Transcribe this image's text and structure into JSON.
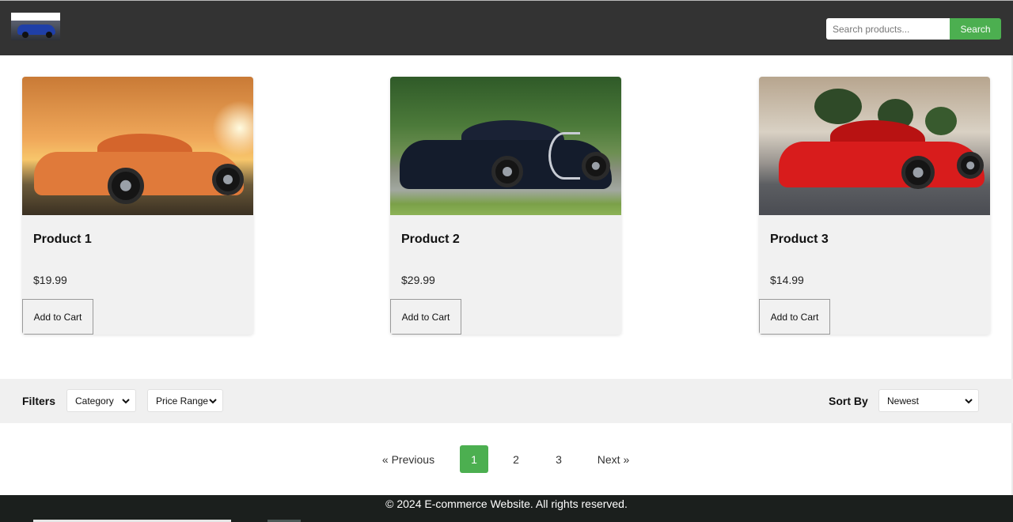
{
  "header": {
    "logo_alt": "car logo",
    "search_placeholder": "Search products...",
    "search_button": "Search"
  },
  "products": [
    {
      "name": "Product 1",
      "price": "$19.99",
      "button": "Add to Cart",
      "image": "orange sports car at sunset",
      "color": "#e07a3a"
    },
    {
      "name": "Product 2",
      "price": "$29.99",
      "button": "Add to Cart",
      "image": "black hypercar on track",
      "color": "#141c2c"
    },
    {
      "name": "Product 3",
      "price": "$14.99",
      "button": "Add to Cart",
      "image": "red supercar on street",
      "color": "#d81c1c"
    }
  ],
  "filters": {
    "label": "Filters",
    "category": "Category",
    "price_range": "Price Range",
    "sort_label": "Sort By",
    "sort_value": "Newest"
  },
  "pagination": {
    "previous": "« Previous",
    "pages": [
      "1",
      "2",
      "3"
    ],
    "active_page": "1",
    "next": "Next »"
  },
  "footer": {
    "text": "© 2024 E-commerce Website. All rights reserved."
  },
  "colors": {
    "header_bg": "#333333",
    "accent": "#4caf50",
    "card_bg": "#f1f1f1",
    "footer_bg": "#1b1f1d"
  }
}
